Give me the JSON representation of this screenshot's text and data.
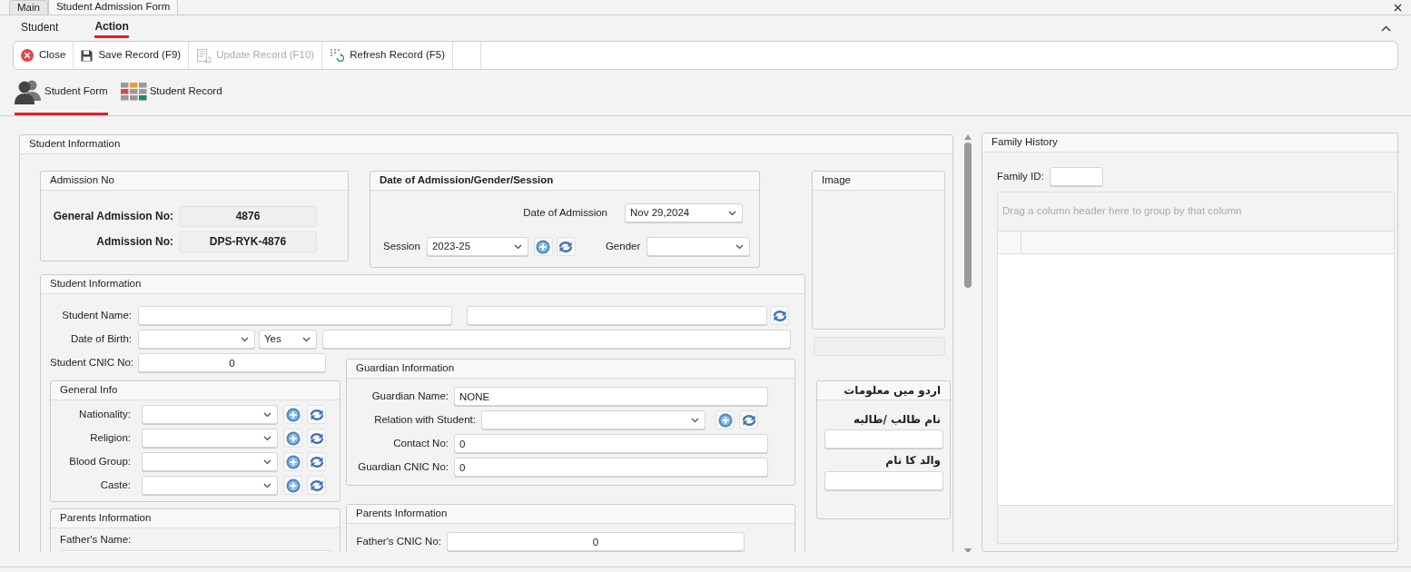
{
  "doc_tabs": [
    {
      "label": "Main",
      "selected": false
    },
    {
      "label": "Student Admission Form",
      "selected": true
    }
  ],
  "ribbon_tabs": [
    {
      "label": "Student",
      "selected": false
    },
    {
      "label": "Action",
      "selected": true
    }
  ],
  "toolbar": [
    {
      "label": "Close",
      "kind": "close",
      "disabled": false
    },
    {
      "label": "Save Record (F9)",
      "kind": "save",
      "disabled": false
    },
    {
      "label": "Update Record (F10)",
      "kind": "update",
      "disabled": true
    },
    {
      "label": "Refresh Record (F5)",
      "kind": "refresh",
      "disabled": false
    }
  ],
  "views": [
    {
      "label": "Student Form",
      "kind": "users",
      "selected": true
    },
    {
      "label": "Student Record",
      "kind": "tiles",
      "selected": false
    }
  ],
  "student_panel": {
    "title": "Student Information",
    "admission": {
      "title": "Admission No",
      "fields": [
        {
          "label": "General Admission No:",
          "value": "4876"
        },
        {
          "label": "Admission No:",
          "value": "DPS-RYK-4876"
        }
      ]
    },
    "date_box": {
      "title": "Date of Admission/Gender/Session",
      "date_label": "Date of Admission",
      "date_value": "Nov 29,2024",
      "session_label": "Session",
      "session_value": "2023-25",
      "gender_label": "Gender"
    },
    "image": {
      "title": "Image"
    },
    "student_info": {
      "title": "Student Information",
      "name_label": "Student Name:",
      "dob_label": "Date of Birth:",
      "dob_flag": "Yes",
      "cnic_label": "Student CNIC No:",
      "cnic_value": "0"
    },
    "general_info": {
      "title": "General Info",
      "rows": [
        {
          "label": "Nationality:"
        },
        {
          "label": "Religion:"
        },
        {
          "label": "Blood Group:"
        },
        {
          "label": "Caste:"
        }
      ]
    },
    "guardian": {
      "title": "Guardian Information",
      "fields": [
        {
          "label": "Guardian Name:",
          "kind": "text",
          "value": "NONE"
        },
        {
          "label": "Relation with Student:",
          "kind": "select"
        },
        {
          "label": "Contact No:",
          "kind": "text",
          "value": "0"
        },
        {
          "label": "Guardian CNIC No:",
          "kind": "text",
          "value": "0"
        }
      ]
    },
    "parents_left": {
      "title": "Parents Information",
      "label": "Father's Name:"
    },
    "parents_right": {
      "title": "Parents Information",
      "label": "Father's CNIC No:",
      "value": "0"
    },
    "urdu": {
      "title": "اردو میں معلومات",
      "fields": [
        {
          "label": "نام طالب /طالبه"
        },
        {
          "label": "والد کا نام"
        }
      ]
    }
  },
  "family_history": {
    "title": "Family History",
    "family_id_label": "Family ID:",
    "grid_hint": "Drag a column header here to group by that column"
  }
}
